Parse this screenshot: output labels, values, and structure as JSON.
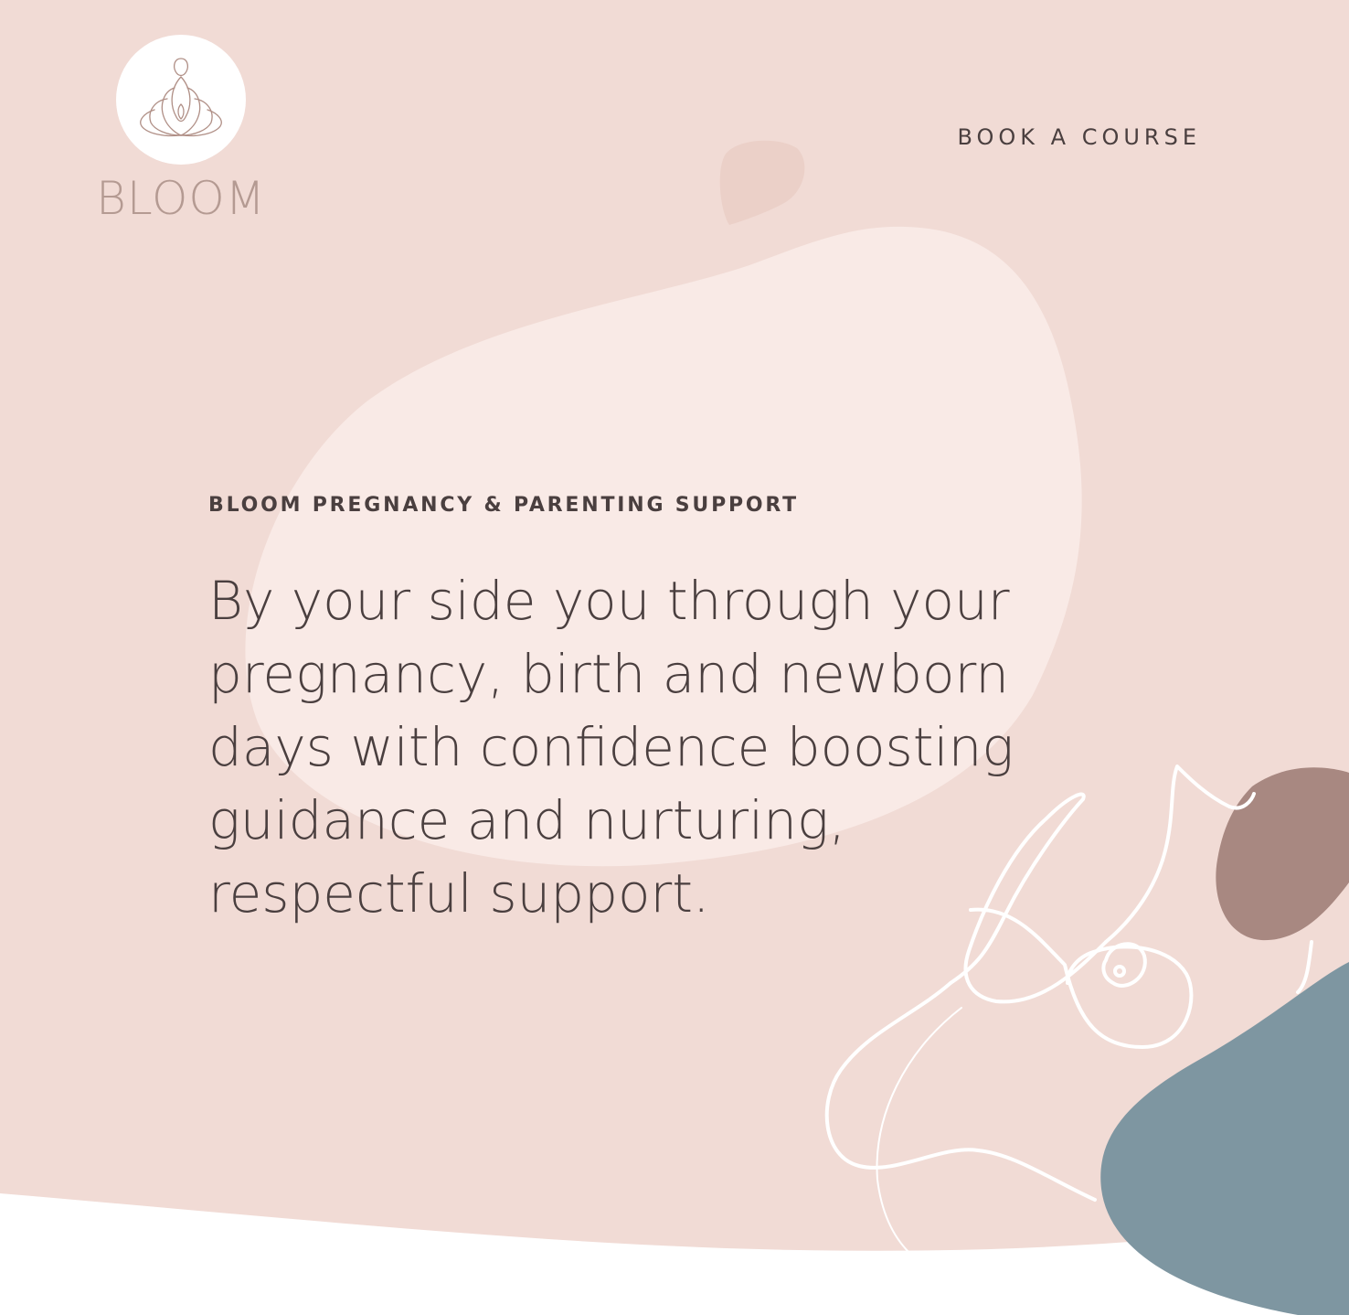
{
  "brand": {
    "name": "BLOOM",
    "logo_icon": "lotus-woman-icon"
  },
  "nav": {
    "book_course": "BOOK A COURSE"
  },
  "hero": {
    "eyebrow": "BLOOM PREGNANCY & PARENTING SUPPORT",
    "headline": "By your side you through your pregnancy, birth and newborn days with confidence boosting guidance and nurturing, respectful support."
  },
  "colors": {
    "background_pink": "#f1dbd5",
    "light_blob": "#f9eae6",
    "small_blob": "#ebd0c8",
    "mauve_blob": "#a88881",
    "slate_blob": "#7e96a1",
    "text_dark": "#4a3f3f",
    "logo_text": "#b49a92"
  }
}
